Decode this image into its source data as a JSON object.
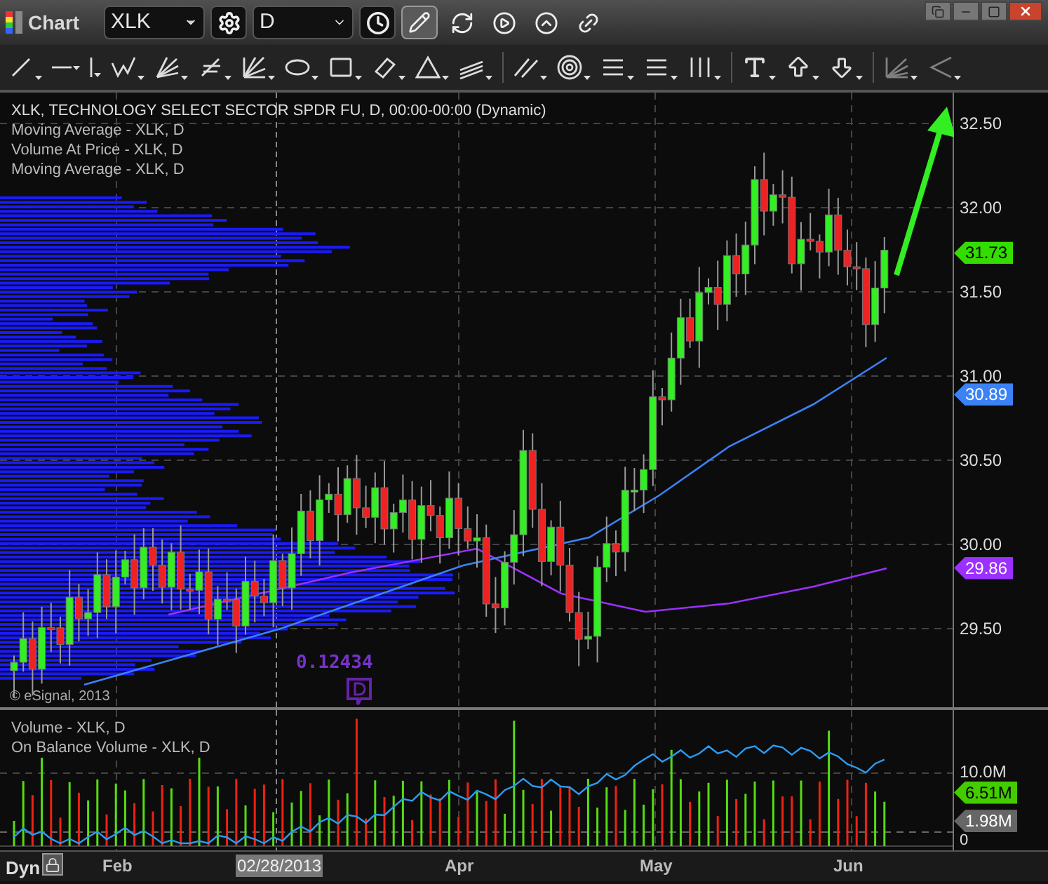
{
  "window": {
    "title": "Chart"
  },
  "toolbar": {
    "symbol": "XLK",
    "interval": "D",
    "drawing_mode": true
  },
  "legend": [
    "XLK, TECHNOLOGY SELECT SECTOR SPDR FU, D, 00:00-00:00 (Dynamic)",
    "Moving Average - XLK, D",
    "Volume At Price - XLK, D",
    "Moving Average - XLK, D"
  ],
  "price_axis": {
    "ticks": [
      "32.50",
      "32.00",
      "31.50",
      "31.00",
      "30.50",
      "30.00",
      "29.50"
    ],
    "tags": [
      {
        "label": "31.73",
        "color": "#33dd00"
      },
      {
        "label": "30.89",
        "color": "#3b82f6"
      },
      {
        "label": "29.86",
        "color": "#9b30ff"
      }
    ]
  },
  "annotation": "0.12434",
  "copyright": "© eSignal, 2013",
  "volume_pane": {
    "legend": [
      "Volume - XLK, D",
      "On Balance Volume - XLK, D"
    ],
    "ticks": [
      "10.0M",
      "0"
    ],
    "tags": [
      {
        "label": "6.51M",
        "color": "#44cc00"
      },
      {
        "label": "1.98M",
        "color": "#666666"
      }
    ]
  },
  "time_axis": {
    "mode": "Dyn",
    "labels": [
      {
        "label": "Feb",
        "selected": false
      },
      {
        "label": "02/28/2013",
        "selected": true
      },
      {
        "label": "Apr",
        "selected": false
      },
      {
        "label": "May",
        "selected": false
      },
      {
        "label": "Jun",
        "selected": false
      }
    ]
  }
}
